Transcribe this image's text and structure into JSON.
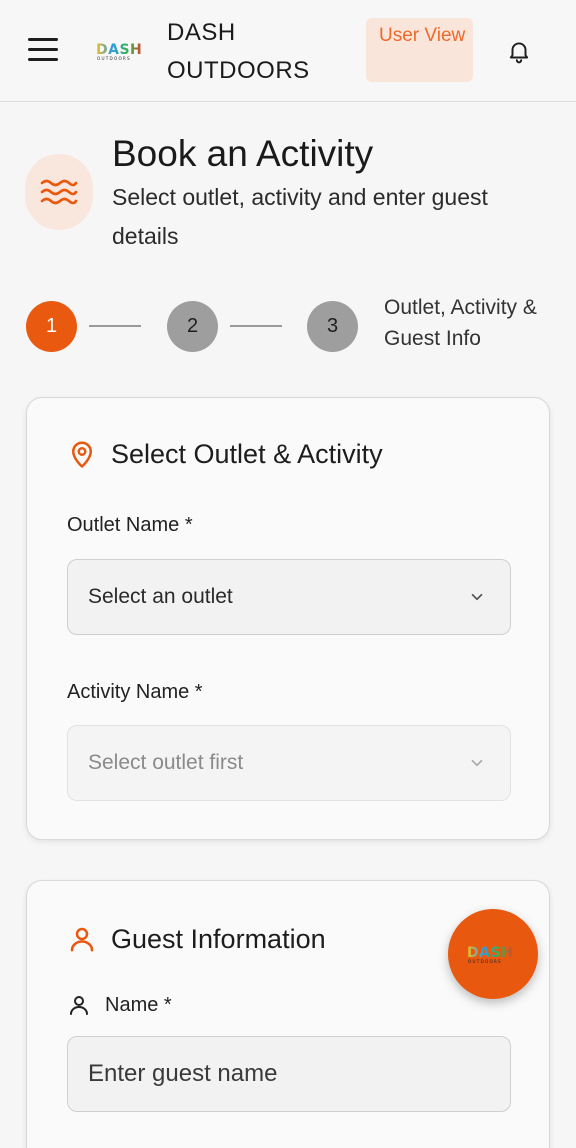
{
  "header": {
    "brand": "DASH OUTDOORS",
    "logo_text": "DASH",
    "logo_subtext": "OUTDOORS",
    "user_view_label": "User View",
    "icons": {
      "menu": "hamburger-icon",
      "notifications": "bell-icon"
    }
  },
  "page": {
    "title": "Book an Activity",
    "subtitle": "Select outlet, activity and enter guest details",
    "icon": "waves-icon"
  },
  "stepper": {
    "steps": [
      "1",
      "2",
      "3"
    ],
    "active_step": 1,
    "caption": "Outlet, Activity & Guest Info"
  },
  "outlet_card": {
    "title": "Select Outlet & Activity",
    "icon": "map-pin-icon",
    "outlet_label": "Outlet Name *",
    "outlet_value": "Select an outlet",
    "activity_label": "Activity Name *",
    "activity_value": "Select outlet first"
  },
  "guest_card": {
    "title": "Guest Information",
    "icon": "user-icon",
    "name_label": "Name *",
    "name_placeholder": "Enter guest name"
  },
  "colors": {
    "accent": "#e95a10",
    "accent_light": "#f9e6dc",
    "inactive_step": "#9e9e9e"
  }
}
